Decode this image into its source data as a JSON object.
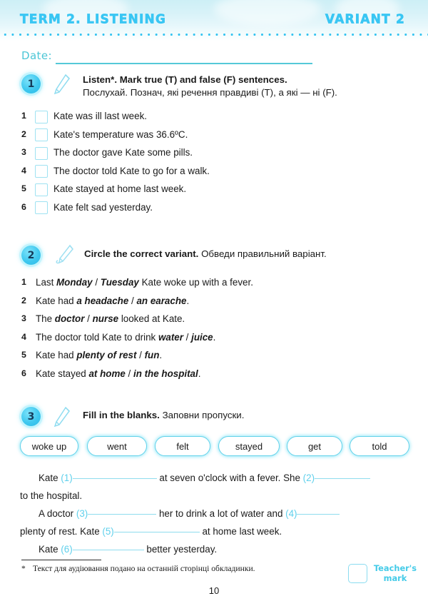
{
  "header": {
    "term_title": "TERM 2.  LISTENING",
    "variant_title": "VARIANT 2",
    "accent_color": "#39c6f3"
  },
  "date_row": {
    "label": "Date:"
  },
  "tasks": [
    {
      "number": "1",
      "icon": "pencil-icon",
      "instruction_en": "Listen*. Mark true (T) and false (F) sentences.",
      "instruction_ua": "Послухай. Познач, які речення правдиві (Т), а які — ні (F).",
      "items": [
        {
          "num": "1",
          "text": "Kate was ill last week."
        },
        {
          "num": "2",
          "text": "Kate's temperature was 36.6ºC."
        },
        {
          "num": "3",
          "text": "The doctor gave Kate some pills."
        },
        {
          "num": "4",
          "text": "The doctor told Kate to go for a walk."
        },
        {
          "num": "5",
          "text": "Kate stayed at home last week."
        },
        {
          "num": "6",
          "text": "Kate felt sad yesterday."
        }
      ]
    },
    {
      "number": "2",
      "icon": "pencil-icon",
      "instruction_en": "Circle the correct variant.",
      "instruction_ua": "Обведи правильний варіант.",
      "items": [
        {
          "num": "1",
          "pre": "Last ",
          "opt1": "Monday",
          "sep": " / ",
          "opt2": "Tuesday",
          "post": " Kate woke up with a fever."
        },
        {
          "num": "2",
          "pre": "Kate had ",
          "opt1": "a headache",
          "sep": " / ",
          "opt2": "an earache",
          "post": "."
        },
        {
          "num": "3",
          "pre": "The ",
          "opt1": "doctor",
          "sep": " / ",
          "opt2": "nurse",
          "post": " looked at Kate."
        },
        {
          "num": "4",
          "pre": "The doctor told Kate to drink ",
          "opt1": "water",
          "sep": " / ",
          "opt2": "juice",
          "post": "."
        },
        {
          "num": "5",
          "pre": "Kate had ",
          "opt1": "plenty of rest",
          "sep": " / ",
          "opt2": "fun",
          "post": "."
        },
        {
          "num": "6",
          "pre": "Kate stayed ",
          "opt1": "at home",
          "sep": " / ",
          "opt2": "in the hospital",
          "post": "."
        }
      ]
    },
    {
      "number": "3",
      "icon": "pencil-icon",
      "instruction_en": "Fill in the blanks.",
      "instruction_ua": "Заповни пропуски."
    }
  ],
  "word_bank": [
    {
      "label": "woke up"
    },
    {
      "label": "went"
    },
    {
      "label": "felt"
    },
    {
      "label": "stayed"
    },
    {
      "label": "get"
    },
    {
      "label": "told"
    }
  ],
  "gapfill": {
    "p1_a": "Kate ",
    "p1_n1": "(1)",
    "p1_b": " at seven o'clock with a fever. She ",
    "p1_n2": "(2)",
    "p1_c": "to the hospital.",
    "p2_a": "A doctor ",
    "p2_n3": "(3)",
    "p2_b": " her to drink a lot of water and ",
    "p2_n4": "(4)",
    "p2_c": "plenty of rest. Kate ",
    "p2_n5": "(5)",
    "p2_d": " at home last week.",
    "p3_a": "Kate ",
    "p3_n6": "(6)",
    "p3_b": " better yesterday."
  },
  "footnote": {
    "marker": "*",
    "text": "Текст для аудіювання подано на останній сторінці обкладинки."
  },
  "teacher_mark": {
    "line1": "Teacher's",
    "line2": "mark"
  },
  "page_number": "10"
}
